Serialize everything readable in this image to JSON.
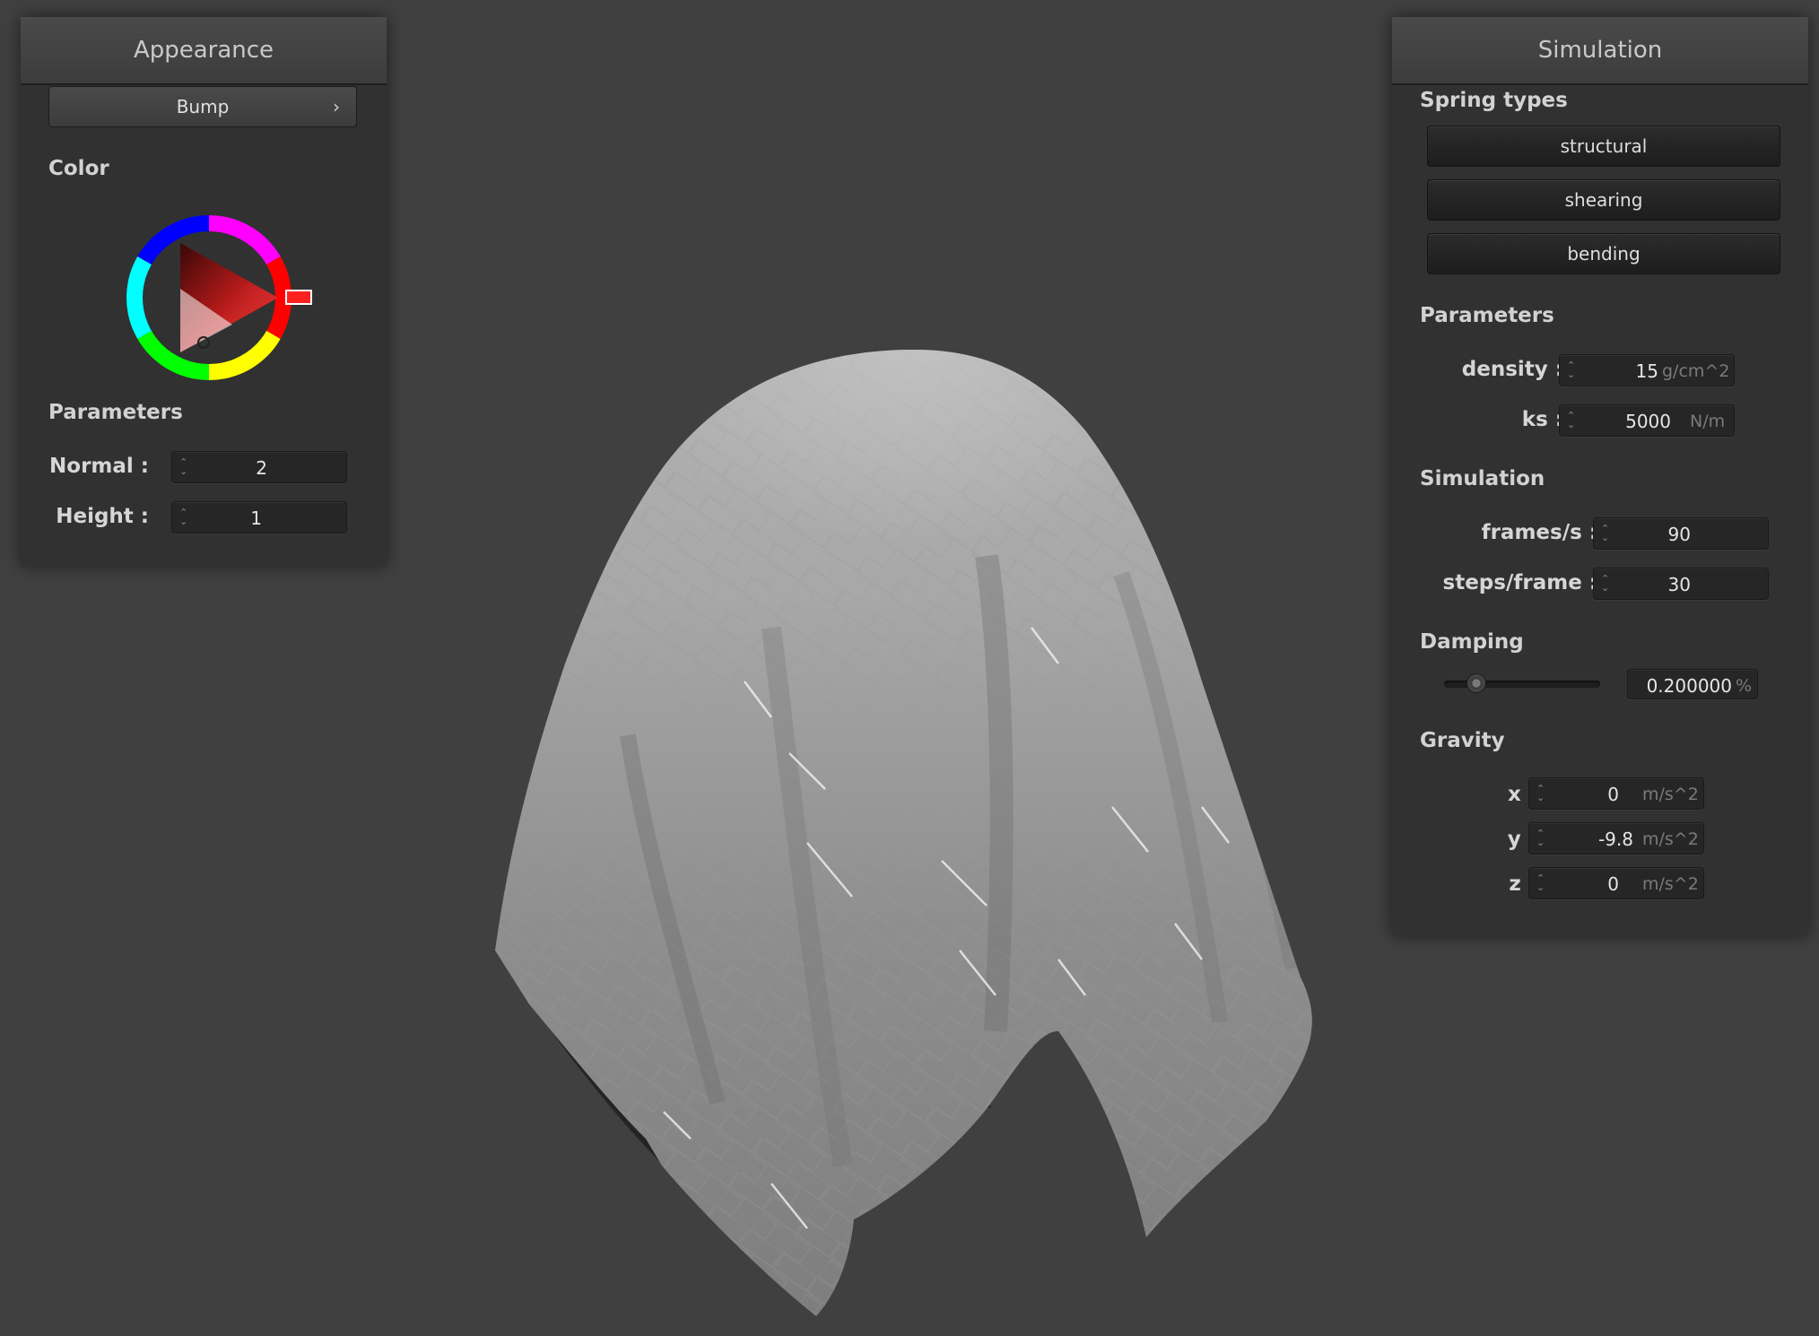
{
  "appearance": {
    "title": "Appearance",
    "mode_dropdown": {
      "value": "Bump",
      "chevron_icon": "chevron-right-icon"
    },
    "color_label": "Color",
    "color_wheel": {
      "selected_color": "#ff0000",
      "icon": "color-wheel-icon"
    },
    "parameters_label": "Parameters",
    "normal": {
      "label": "Normal :",
      "value": "2"
    },
    "height": {
      "label": "Height :",
      "value": "1"
    }
  },
  "simulation": {
    "title": "Simulation",
    "spring_types_label": "Spring types",
    "spring_buttons": {
      "structural": "structural",
      "shearing": "shearing",
      "bending": "bending"
    },
    "parameters_label": "Parameters",
    "density": {
      "label": "density :",
      "value": "15",
      "unit": "g/cm^2"
    },
    "ks": {
      "label": "ks :",
      "value": "5000",
      "unit": "N/m"
    },
    "simulation_label": "Simulation",
    "frames_per_sec": {
      "label": "frames/s :",
      "value": "90"
    },
    "steps_per_frame": {
      "label": "steps/frame :",
      "value": "30"
    },
    "damping_label": "Damping",
    "damping": {
      "slider_fraction": 0.2,
      "value": "0.200000",
      "unit": "%"
    },
    "gravity_label": "Gravity",
    "gravity": {
      "x": {
        "label": "x :",
        "value": "0",
        "unit": "m/s^2"
      },
      "y": {
        "label": "y :",
        "value": "-9.8",
        "unit": "m/s^2"
      },
      "z": {
        "label": "z :",
        "value": "0",
        "unit": "m/s^2"
      }
    }
  },
  "colors": {
    "background": "#404040",
    "panel": "#313131",
    "accent": "#ff0000"
  }
}
